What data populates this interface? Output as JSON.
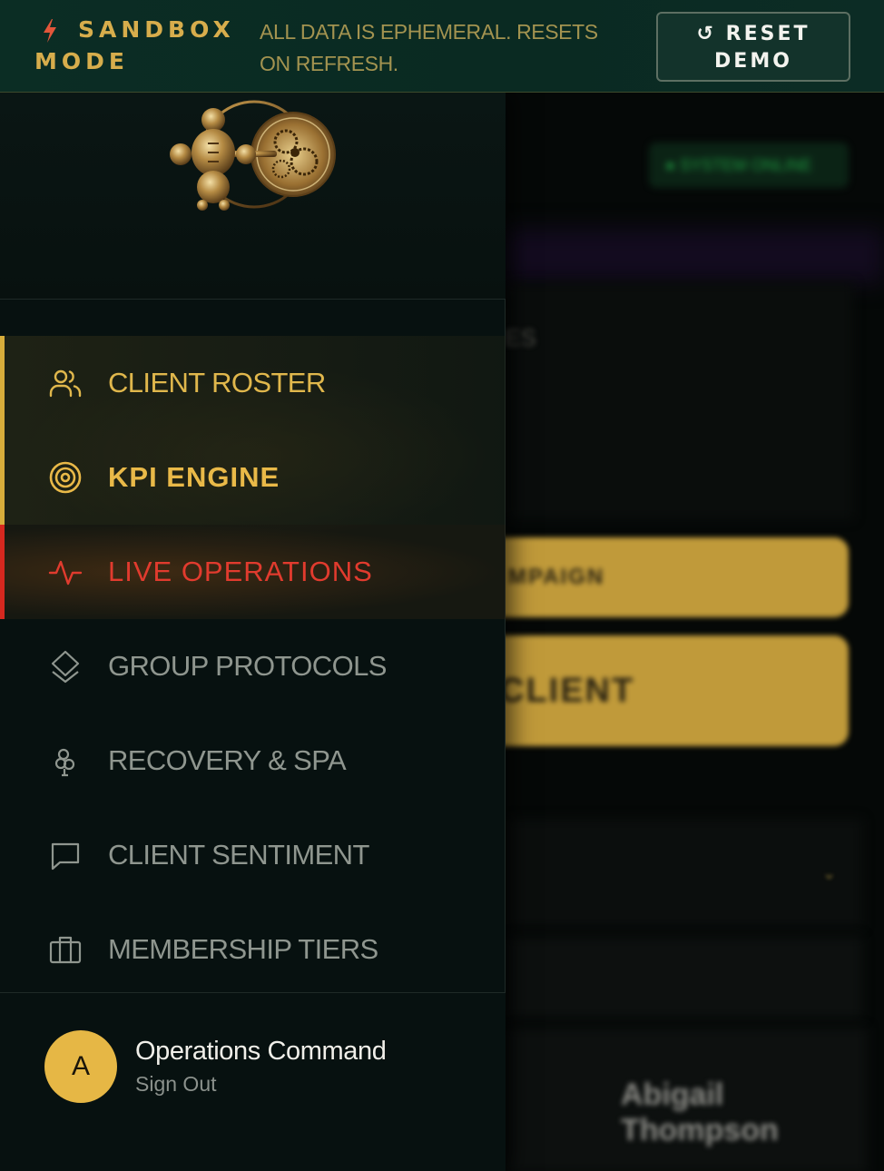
{
  "banner": {
    "mode_line1": "SANDBOX",
    "mode_line2": "MODE",
    "notice": "ALL DATA IS EPHEMERAL. RESETS ON REFRESH.",
    "reset_icon": "↺",
    "reset_label_line1": "RESET",
    "reset_label_line2": "DEMO",
    "icon": "lightning-bolt-icon",
    "accent": "#d7ad4c"
  },
  "drawer": {
    "logo": "bronze-figure-and-gears-logo",
    "nav": [
      {
        "label": "CLIENT ROSTER",
        "icon": "users-icon",
        "state": "highlighted"
      },
      {
        "label": "KPI ENGINE",
        "icon": "target-icon",
        "state": "highlighted-bold"
      },
      {
        "label": "LIVE OPERATIONS",
        "icon": "activity-pulse-icon",
        "state": "active-alert"
      },
      {
        "label": "GROUP PROTOCOLS",
        "icon": "layers-icon",
        "state": "default"
      },
      {
        "label": "RECOVERY & SPA",
        "icon": "flower-icon",
        "state": "default"
      },
      {
        "label": "CLIENT SENTIMENT",
        "icon": "message-square-icon",
        "state": "default"
      },
      {
        "label": "MEMBERSHIP TIERS",
        "icon": "briefcase-icon",
        "state": "default"
      }
    ],
    "user": {
      "initial": "A",
      "name": "Operations Command",
      "sign_out": "Sign Out"
    }
  },
  "background": {
    "status": "● SYSTEM ONLINE",
    "card_text": "ES",
    "gold_button_1": "MPAIGN",
    "gold_button_2": "CLIENT",
    "person": "Abigail Thompson"
  },
  "colors": {
    "gold": "#e0b74c",
    "alert_red": "#e13b2e",
    "banner_bg": "#0b2d24",
    "drawer_bg": "#071110"
  }
}
